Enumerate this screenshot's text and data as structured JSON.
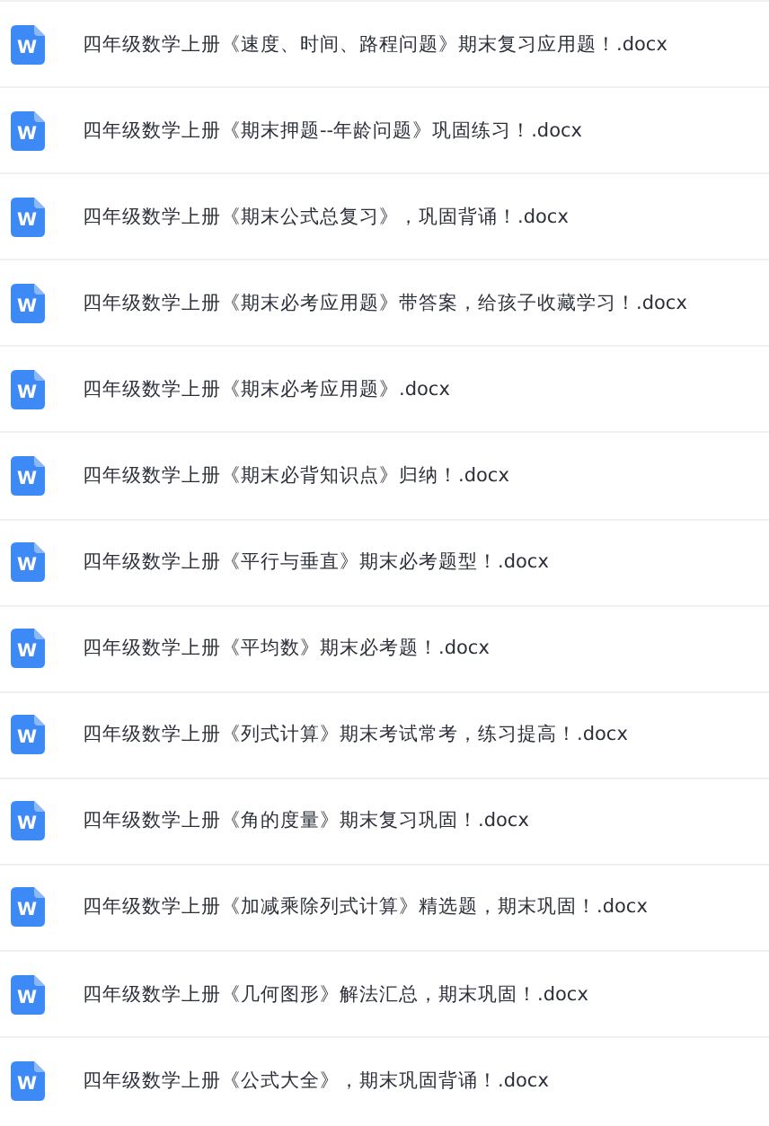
{
  "files": [
    {
      "icon_letter": "W",
      "name": "四年级数学上册《速度、时间、路程问题》期末复习应用题！.docx"
    },
    {
      "icon_letter": "W",
      "name": "四年级数学上册《期末押题--年龄问题》巩固练习！.docx"
    },
    {
      "icon_letter": "W",
      "name": "四年级数学上册《期末公式总复习》，巩固背诵！.docx"
    },
    {
      "icon_letter": "W",
      "name": "四年级数学上册《期末必考应用题》带答案，给孩子收藏学习！.docx"
    },
    {
      "icon_letter": "W",
      "name": "四年级数学上册《期末必考应用题》.docx"
    },
    {
      "icon_letter": "W",
      "name": "四年级数学上册《期末必背知识点》归纳！.docx"
    },
    {
      "icon_letter": "W",
      "name": "四年级数学上册《平行与垂直》期末必考题型！.docx"
    },
    {
      "icon_letter": "W",
      "name": "四年级数学上册《平均数》期末必考题！.docx"
    },
    {
      "icon_letter": "W",
      "name": "四年级数学上册《列式计算》期末考试常考，练习提高！.docx"
    },
    {
      "icon_letter": "W",
      "name": "四年级数学上册《角的度量》期末复习巩固！.docx"
    },
    {
      "icon_letter": "W",
      "name": "四年级数学上册《加减乘除列式计算》精选题，期末巩固！.docx"
    },
    {
      "icon_letter": "W",
      "name": "四年级数学上册《几何图形》解法汇总，期末巩固！.docx"
    },
    {
      "icon_letter": "W",
      "name": "四年级数学上册《公式大全》，期末巩固背诵！.docx"
    }
  ]
}
